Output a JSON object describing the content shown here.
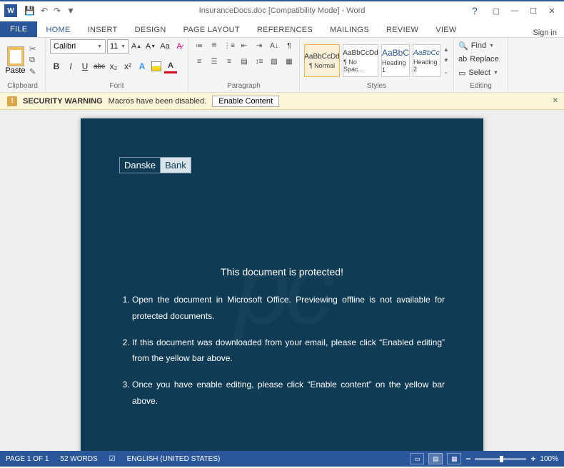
{
  "titlebar": {
    "title": "InsuranceDocs.doc [Compatibility Mode] - Word",
    "word_letter": "W"
  },
  "tabs": {
    "file": "FILE",
    "items": [
      "HOME",
      "INSERT",
      "DESIGN",
      "PAGE LAYOUT",
      "REFERENCES",
      "MAILINGS",
      "REVIEW",
      "VIEW"
    ],
    "active": "HOME",
    "signin": "Sign in"
  },
  "ribbon": {
    "clipboard": {
      "paste": "Paste",
      "label": "Clipboard"
    },
    "font": {
      "name": "Calibri",
      "size": "11",
      "label": "Font",
      "bold": "B",
      "italic": "I",
      "under": "U",
      "strike": "abc",
      "sub": "x₂",
      "sup": "x²",
      "aa": "Aa",
      "clear": "A"
    },
    "paragraph": {
      "label": "Paragraph",
      "pilcrow": "¶"
    },
    "styles": {
      "label": "Styles",
      "items": [
        {
          "preview": "AaBbCcDd",
          "name": "¶ Normal"
        },
        {
          "preview": "AaBbCcDd",
          "name": "¶ No Spac..."
        },
        {
          "preview": "AaBbC",
          "name": "Heading 1"
        },
        {
          "preview": "AaBbCc",
          "name": "Heading 2"
        }
      ]
    },
    "editing": {
      "label": "Editing",
      "find": "Find",
      "replace": "Replace",
      "select": "Select"
    }
  },
  "security": {
    "title": "SECURITY WARNING",
    "message": "Macros have been disabled.",
    "button": "Enable Content",
    "icon": "!"
  },
  "document": {
    "logo_left": "Danske",
    "logo_right": "Bank",
    "title": "This document is protected!",
    "steps": [
      "Open the document in Microsoft Office. Previewing offline is not available for protected documents.",
      "If this document was downloaded from your email, please click “Enabled editing” from the yellow bar above.",
      "Once you have enable editing, please click “Enable content” on the yellow bar above."
    ]
  },
  "status": {
    "page": "PAGE 1 OF 1",
    "words": "52 WORDS",
    "lang": "ENGLISH (UNITED STATES)",
    "zoom": "100%"
  }
}
